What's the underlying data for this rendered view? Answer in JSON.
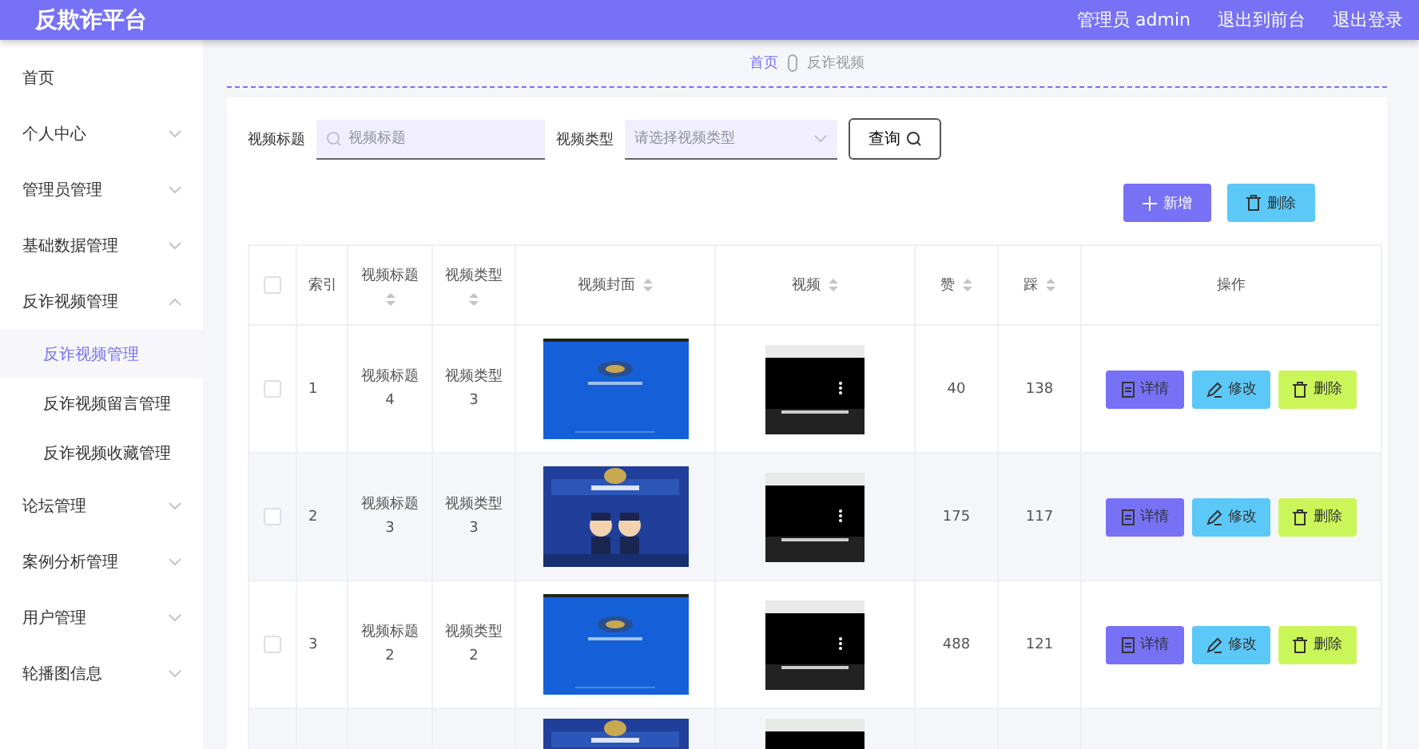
{
  "header": {
    "title": "反欺诈平台",
    "user": "管理员 admin",
    "links": [
      "退出到前台",
      "退出登录"
    ]
  },
  "sidebar": {
    "items": [
      {
        "kind": "link",
        "label": "首页"
      },
      {
        "kind": "menu",
        "label": "个人中心",
        "expanded": false
      },
      {
        "kind": "menu",
        "label": "管理员管理",
        "expanded": false
      },
      {
        "kind": "menu",
        "label": "基础数据管理",
        "expanded": false
      },
      {
        "kind": "menu",
        "label": "反诈视频管理",
        "expanded": true,
        "children": [
          {
            "label": "反诈视频管理",
            "selected": true
          },
          {
            "label": "反诈视频留言管理",
            "selected": false
          },
          {
            "label": "反诈视频收藏管理",
            "selected": false
          }
        ]
      },
      {
        "kind": "menu",
        "label": "论坛管理",
        "expanded": false
      },
      {
        "kind": "menu",
        "label": "案例分析管理",
        "expanded": false
      },
      {
        "kind": "menu",
        "label": "用户管理",
        "expanded": false
      },
      {
        "kind": "menu",
        "label": "轮播图信息",
        "expanded": false
      }
    ]
  },
  "breadcrumb": [
    {
      "label": "首页",
      "current": false
    },
    {
      "label": "反诈视频",
      "current": true
    }
  ],
  "filters": [
    {
      "kind": "text",
      "label": "视频标题",
      "placeholder": "视频标题"
    },
    {
      "kind": "select",
      "label": "视频类型",
      "placeholder": "请选择视频类型"
    }
  ],
  "query_button": "查询",
  "actions": [
    {
      "kind": "add",
      "label": "新增"
    },
    {
      "kind": "delete",
      "label": "删除"
    }
  ],
  "table": {
    "columns": [
      {
        "kind": "check",
        "checked": false
      },
      {
        "kind": "text",
        "label": "索引",
        "sortable": false
      },
      {
        "kind": "text",
        "label": "视频标题",
        "sortable": true
      },
      {
        "kind": "text",
        "label": "视频类型",
        "sortable": true
      },
      {
        "kind": "cover",
        "label": "视频封面",
        "sortable": true
      },
      {
        "kind": "video",
        "label": "视频",
        "sortable": true
      },
      {
        "kind": "text",
        "label": "赞",
        "sortable": true
      },
      {
        "kind": "text",
        "label": "踩",
        "sortable": true
      },
      {
        "kind": "ops",
        "label": "操作",
        "sortable": false
      }
    ],
    "rows": [
      {
        "kind": "full",
        "checked": false,
        "index": "1",
        "title": "视频标题4",
        "type": "视频类型3",
        "likes": "40",
        "dislikes": "138",
        "buttons": [
          {
            "kind": "detail",
            "label": "详情"
          },
          {
            "kind": "edit",
            "label": "修改"
          },
          {
            "kind": "delete",
            "label": "删除"
          }
        ]
      },
      {
        "kind": "full",
        "checked": false,
        "index": "2",
        "title": "视频标题3",
        "type": "视频类型3",
        "likes": "175",
        "dislikes": "117",
        "buttons": [
          {
            "kind": "detail",
            "label": "详情"
          },
          {
            "kind": "edit",
            "label": "修改"
          },
          {
            "kind": "delete",
            "label": "删除"
          }
        ]
      },
      {
        "kind": "full",
        "checked": false,
        "index": "3",
        "title": "视频标题2",
        "type": "视频类型2",
        "likes": "488",
        "dislikes": "121",
        "buttons": [
          {
            "kind": "detail",
            "label": "详情"
          },
          {
            "kind": "edit",
            "label": "修改"
          },
          {
            "kind": "delete",
            "label": "删除"
          }
        ]
      },
      {
        "kind": "cut"
      }
    ]
  }
}
